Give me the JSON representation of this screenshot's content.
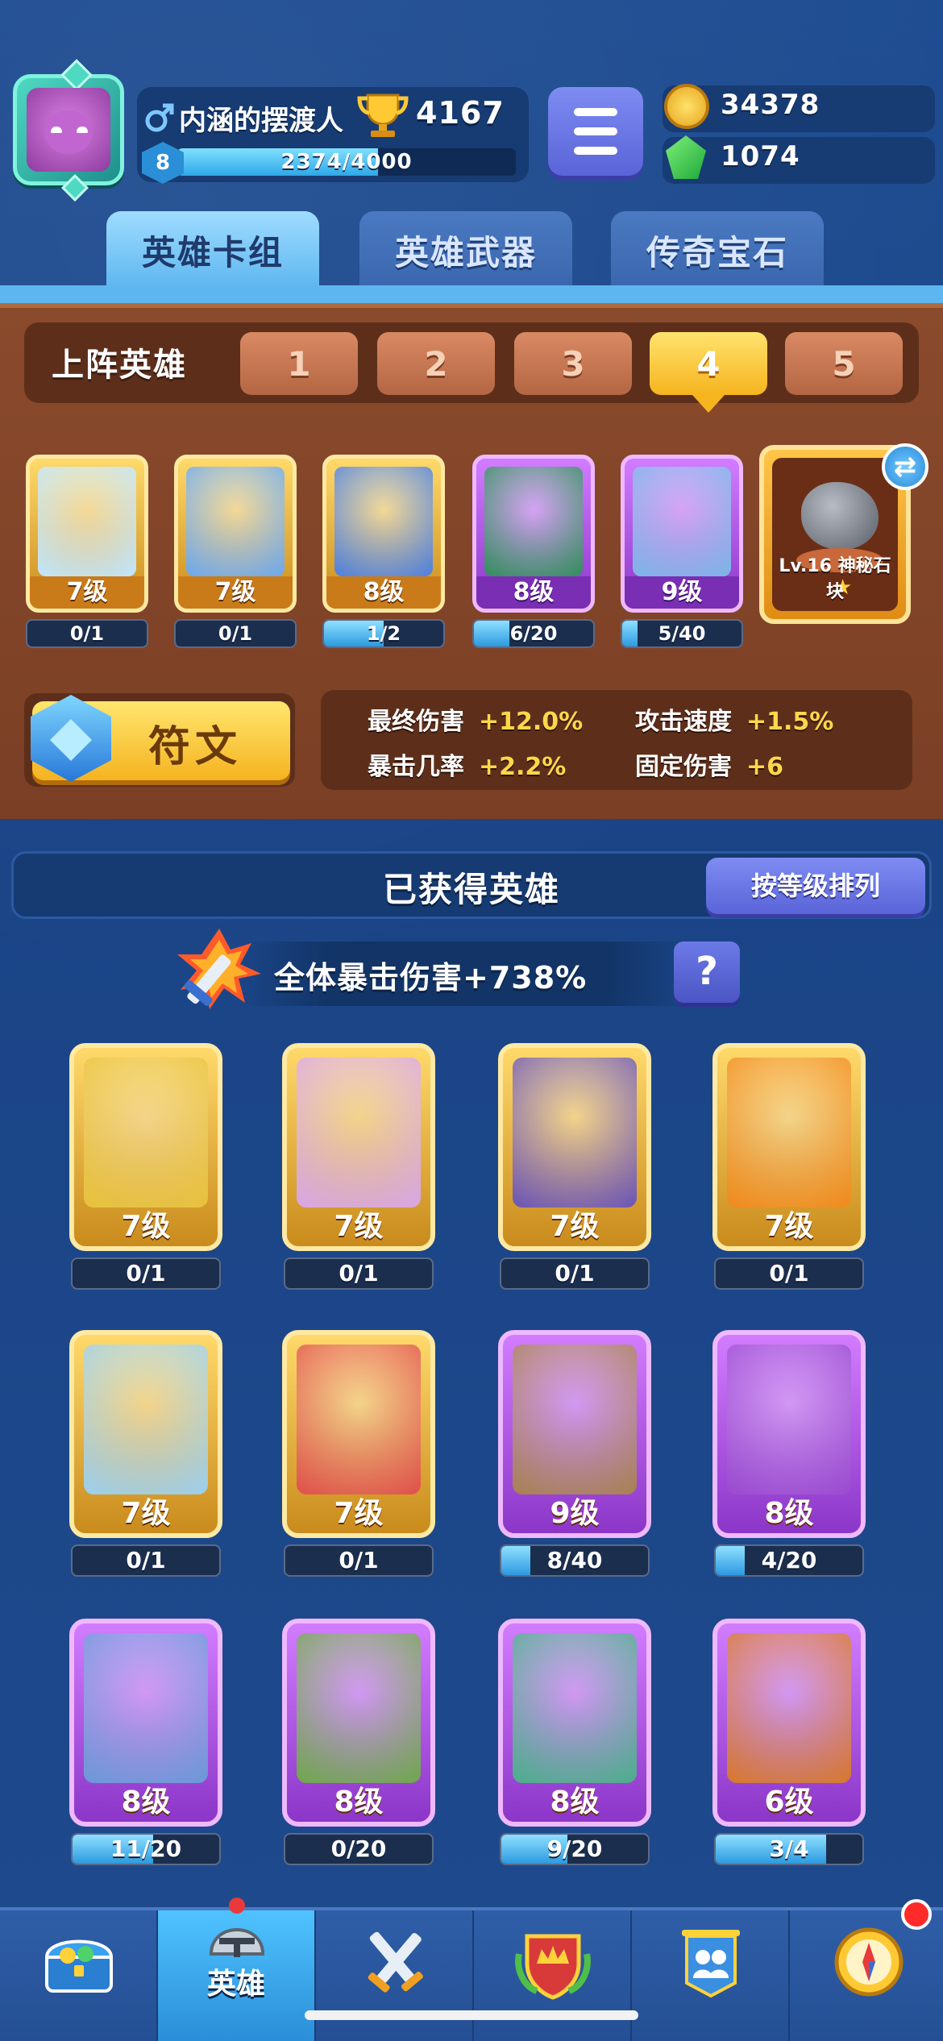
{
  "player": {
    "name": "内涵的摆渡人",
    "trophies": "4167",
    "level": "8",
    "xp_text": "2374/4000",
    "xp_fraction": 0.5935
  },
  "currency": {
    "coins": "34378",
    "gems": "1074"
  },
  "top_tabs": [
    {
      "label": "英雄卡组",
      "active": true
    },
    {
      "label": "英雄武器",
      "active": false
    },
    {
      "label": "传奇宝石",
      "active": false
    }
  ],
  "lineup": {
    "label": "上阵英雄",
    "decks": [
      "1",
      "2",
      "3",
      "4",
      "5"
    ],
    "active_deck": "4",
    "heroes": [
      {
        "level": "7级",
        "progress": "0/1",
        "fill": 0,
        "rarity": "gold",
        "color": "#bfe6ff"
      },
      {
        "level": "7级",
        "progress": "0/1",
        "fill": 0,
        "rarity": "gold",
        "color": "#6aa8f0"
      },
      {
        "level": "8级",
        "progress": "1/2",
        "fill": 0.5,
        "rarity": "gold",
        "color": "#4a7fe0"
      },
      {
        "level": "8级",
        "progress": "6/20",
        "fill": 0.3,
        "rarity": "purple",
        "color": "#2f8f5a"
      },
      {
        "level": "9级",
        "progress": "5/40",
        "fill": 0.125,
        "rarity": "purple",
        "color": "#7bb6e8"
      }
    ],
    "stone_label": "Lv.16 神秘石块"
  },
  "rune": {
    "label": "符文"
  },
  "stats": [
    {
      "name": "最终伤害",
      "value": "+12.0%"
    },
    {
      "name": "攻击速度",
      "value": "+1.5%"
    },
    {
      "name": "暴击几率",
      "value": "+2.2%"
    },
    {
      "name": "固定伤害",
      "value": "+6"
    }
  ],
  "obtained": {
    "title": "已获得英雄",
    "sort_label": "按等级排列",
    "crit_text": "全体暴击伤害+738%",
    "help_label": "?",
    "heroes": [
      {
        "level": "7级",
        "progress": "0/1",
        "fill": 0,
        "rarity": "gold",
        "color": "#e8c23a"
      },
      {
        "level": "7级",
        "progress": "0/1",
        "fill": 0,
        "rarity": "gold",
        "color": "#d8a6e8"
      },
      {
        "level": "7级",
        "progress": "0/1",
        "fill": 0,
        "rarity": "gold",
        "color": "#6a54b8"
      },
      {
        "level": "7级",
        "progress": "0/1",
        "fill": 0,
        "rarity": "gold",
        "color": "#f08a1a"
      },
      {
        "level": "7级",
        "progress": "0/1",
        "fill": 0,
        "rarity": "gold",
        "color": "#9ad0f0"
      },
      {
        "level": "7级",
        "progress": "0/1",
        "fill": 0,
        "rarity": "gold",
        "color": "#e0504a"
      },
      {
        "level": "9级",
        "progress": "8/40",
        "fill": 0.2,
        "rarity": "purple",
        "color": "#a8824e"
      },
      {
        "level": "8级",
        "progress": "4/20",
        "fill": 0.2,
        "rarity": "purple",
        "color": "#9a4ad0"
      },
      {
        "level": "8级",
        "progress": "11/20",
        "fill": 0.55,
        "rarity": "purple",
        "color": "#6a9ad8"
      },
      {
        "level": "8级",
        "progress": "0/20",
        "fill": 0,
        "rarity": "purple",
        "color": "#6fa84a"
      },
      {
        "level": "8级",
        "progress": "9/20",
        "fill": 0.45,
        "rarity": "purple",
        "color": "#4ab08a"
      },
      {
        "level": "6级",
        "progress": "3/4",
        "fill": 0.75,
        "rarity": "purple",
        "color": "#d8782a"
      }
    ]
  },
  "bottom_nav": [
    {
      "label": "",
      "icon": "treasure-chest-icon",
      "active": false
    },
    {
      "label": "英雄",
      "icon": "knight-helmet-icon",
      "active": true
    },
    {
      "label": "",
      "icon": "crossed-swords-icon",
      "active": false
    },
    {
      "label": "",
      "icon": "crown-shield-icon",
      "active": false
    },
    {
      "label": "",
      "icon": "guild-banner-icon",
      "active": false
    },
    {
      "label": "",
      "icon": "compass-icon",
      "active": false
    }
  ],
  "colors": {
    "background": "#1d4a8c",
    "lineup_panel": "#8a4a2c",
    "gold_card": "#ffd96b",
    "purple_card": "#d27cff",
    "stat_value": "#ffd74a",
    "active_tab": "#5eb6f0"
  }
}
